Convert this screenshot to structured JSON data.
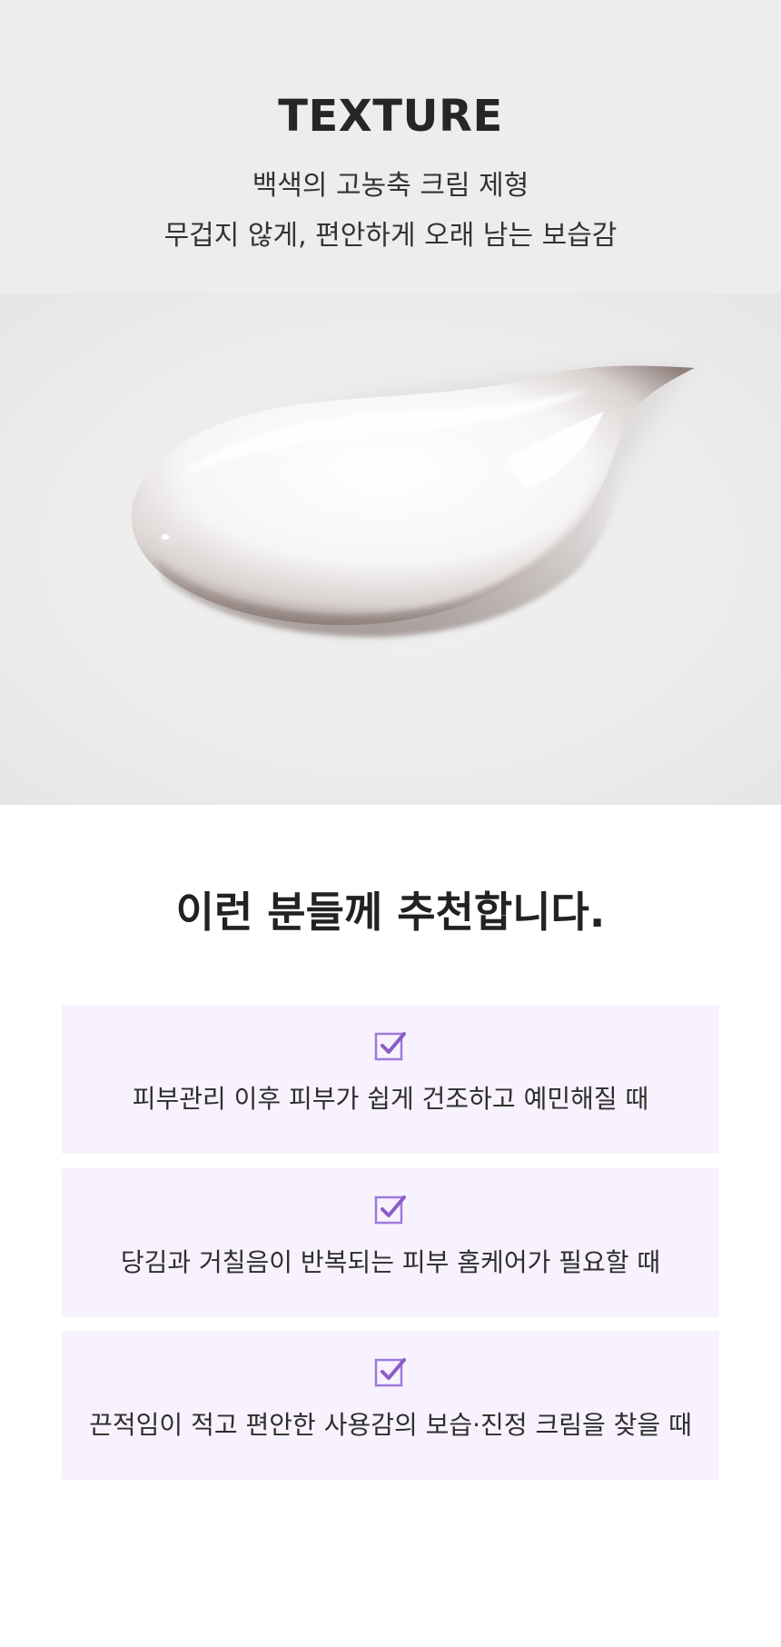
{
  "texture": {
    "title": "TEXTURE",
    "line1": "백색의 고농축 크림 제형",
    "line2": "무겁지 않게, 편안하게 오래 남는 보습감"
  },
  "recommend": {
    "title": "이런 분들께 추천합니다.",
    "items": [
      {
        "icon": "checkbox-checked-icon",
        "text": "피부관리 이후 피부가 쉽게 건조하고 예민해질 때"
      },
      {
        "icon": "checkbox-checked-icon",
        "text": "당김과 거칠음이 반복되는 피부 홈케어가 필요할 때"
      },
      {
        "icon": "checkbox-checked-icon",
        "text": "끈적임이 적고 편안한 사용감의 보습·진정 크림을 찾을 때"
      }
    ]
  },
  "colors": {
    "header_bg": "#ededed",
    "card_bg": "#f7f2fd",
    "check_accent": "#9b6fd6"
  }
}
